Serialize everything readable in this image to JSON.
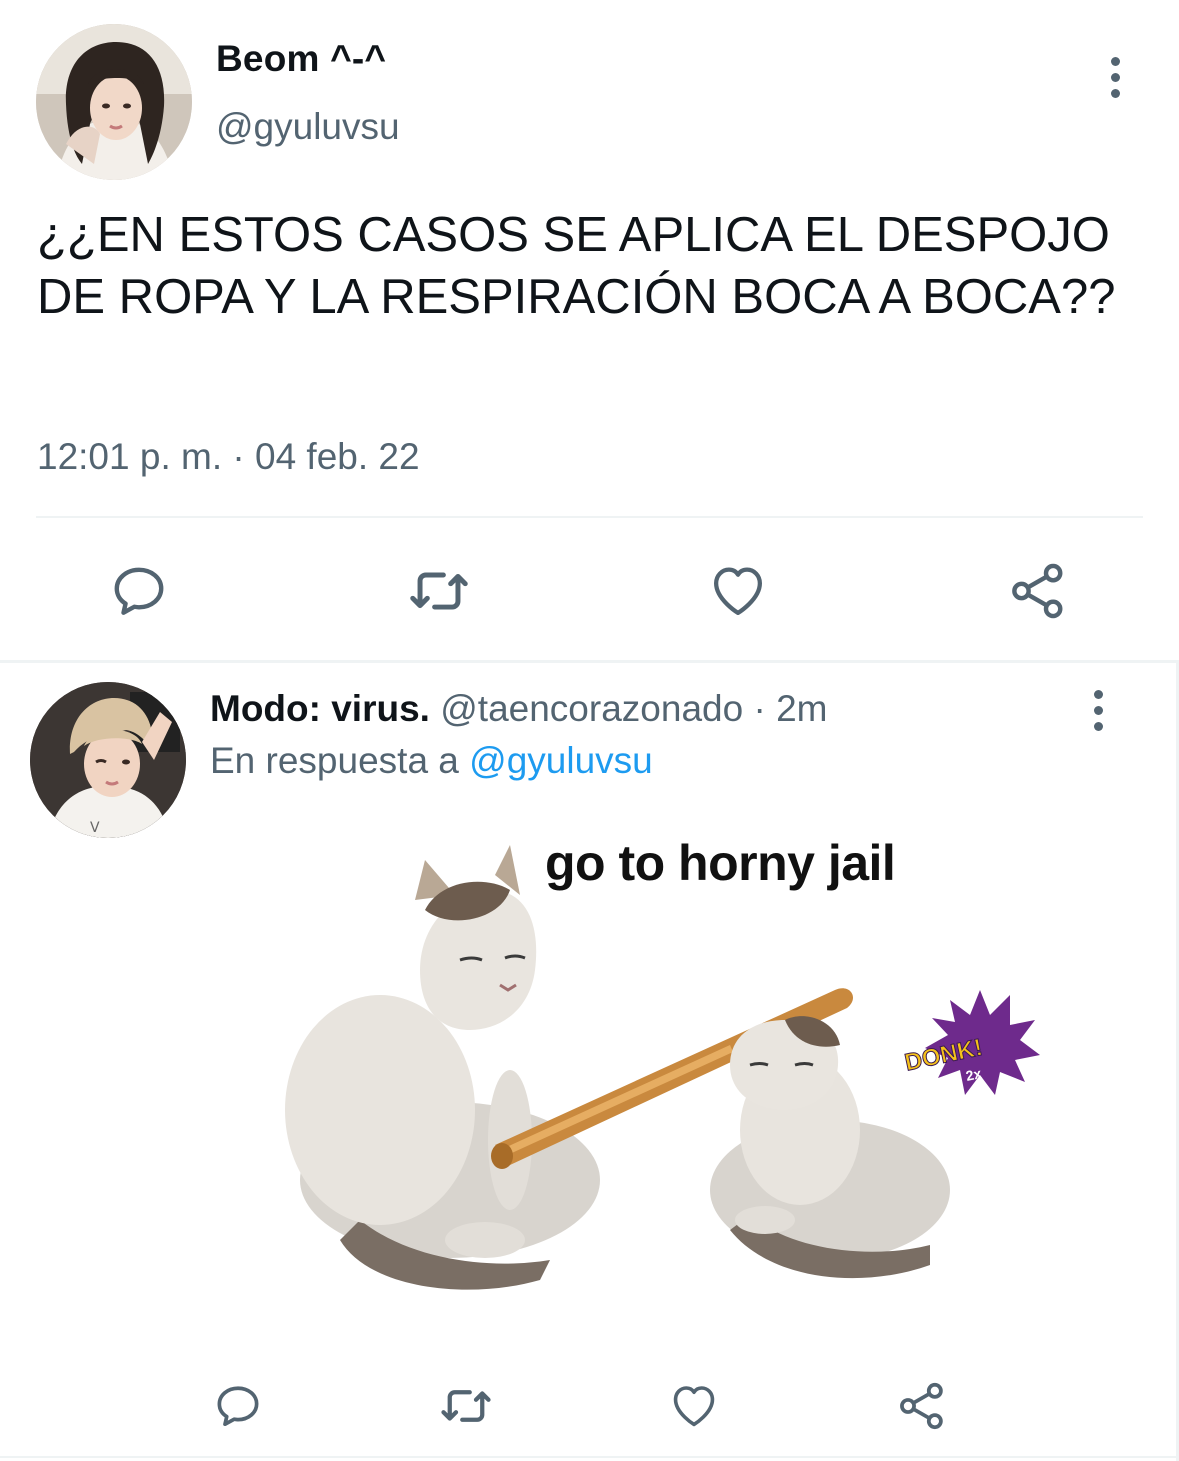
{
  "main_tweet": {
    "display_name": "Beom ^-^",
    "handle": "@gyuluvsu",
    "text": "¿¿EN ESTOS CASOS SE APLICA EL DESPOJO DE ROPA Y LA RESPIRACIÓN BOCA A BOCA??",
    "time": "12:01 p. m.",
    "separator": " · ",
    "date": "04 feb. 22",
    "avatar_icon": "user-photo-avatar",
    "more_icon": "kebab-menu-icon",
    "actions": [
      "reply-icon",
      "retweet-icon",
      "like-icon",
      "share-icon"
    ]
  },
  "reply_tweet": {
    "display_name": "Modo: virus.",
    "handle": "@taencorazonado",
    "separator": " · ",
    "time_ago": "2m",
    "replying_prefix": "En respuesta a ",
    "replying_to": "@gyuluvsu",
    "avatar_icon": "user-photo-avatar",
    "more_icon": "kebab-menu-icon",
    "media": {
      "caption": "go to horny jail",
      "badge_text": "DONK!",
      "badge_sub": "2x"
    },
    "actions": [
      "reply-icon",
      "retweet-icon",
      "like-icon",
      "share-icon"
    ]
  },
  "colors": {
    "text_primary": "#0f1419",
    "text_secondary": "#536471",
    "link": "#1d9bf0",
    "divider": "#eff3f4"
  }
}
